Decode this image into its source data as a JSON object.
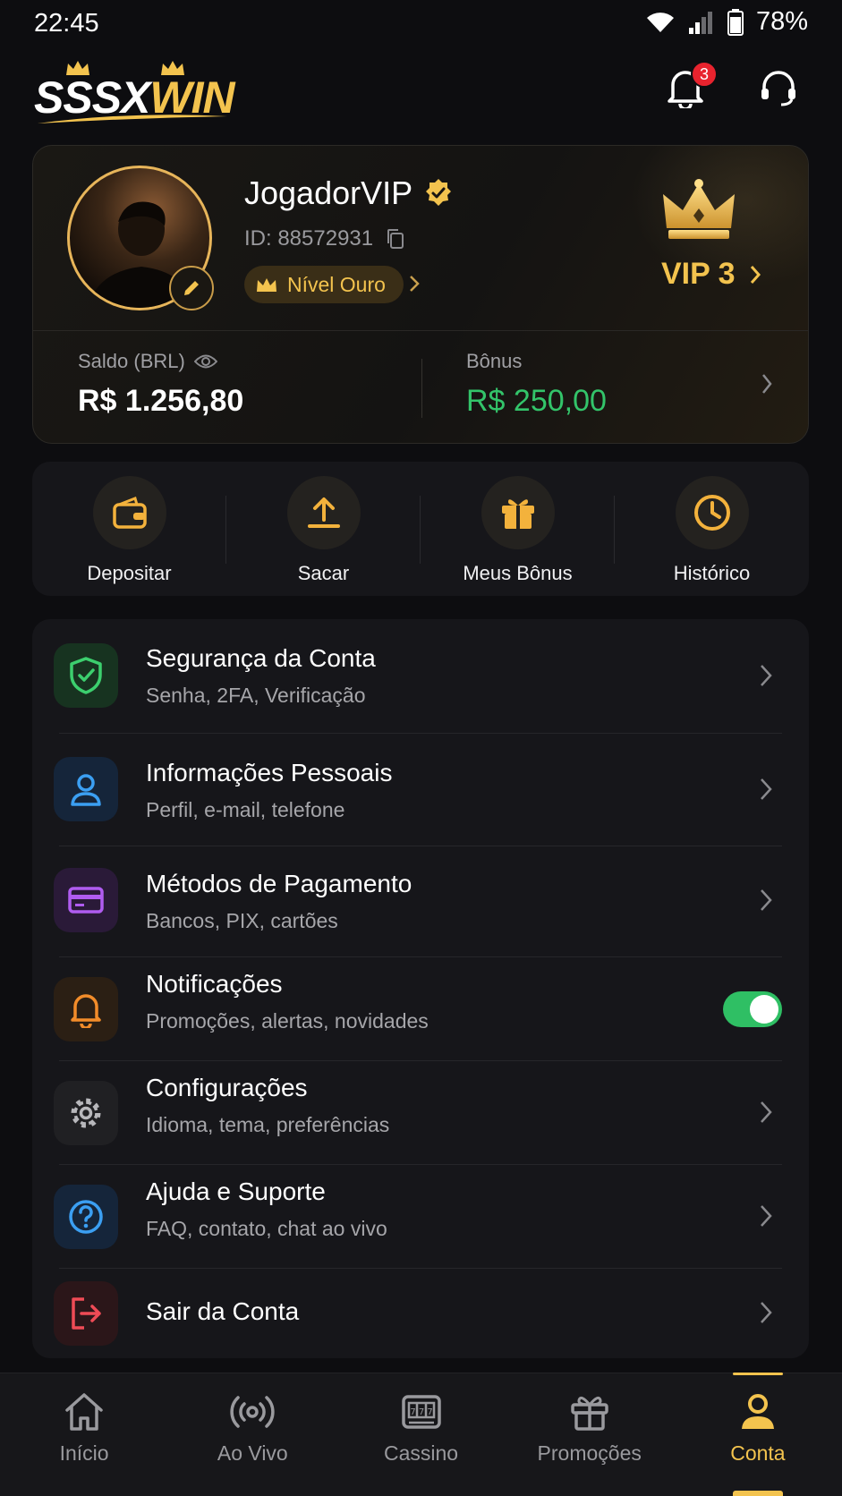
{
  "status_bar": {
    "time": "22:45",
    "battery": "78%"
  },
  "header": {
    "logo_part1": "SSSX",
    "logo_part2": "WIN",
    "notification_count": "3"
  },
  "profile": {
    "username": "JogadorVIP",
    "id": "ID: 88572931",
    "level": "Nível Ouro",
    "vip": "VIP 3",
    "balance_label": "Saldo (BRL)",
    "balance_value": "R$ 1.256,80",
    "bonus_label": "Bônus",
    "bonus_value": "R$ 250,00"
  },
  "actions": [
    {
      "label": "Depositar",
      "icon": "wallet-icon"
    },
    {
      "label": "Sacar",
      "icon": "upload-icon"
    },
    {
      "label": "Meus Bônus",
      "icon": "gift-icon"
    },
    {
      "label": "Histórico",
      "icon": "clock-icon"
    }
  ],
  "menu": [
    {
      "title": "Segurança da Conta",
      "subtitle": "Senha, 2FA, Verificação",
      "icon": "shield-check-icon",
      "color": "#3ccf6e"
    },
    {
      "title": "Informações Pessoais",
      "subtitle": "Perfil, e-mail, telefone",
      "icon": "user-icon",
      "color": "#3b9ff2"
    },
    {
      "title": "Métodos de Pagamento",
      "subtitle": "Bancos, PIX, cartões",
      "icon": "card-icon",
      "color": "#b05cf0"
    },
    {
      "title": "Notificações",
      "subtitle": "Promoções, alertas, novidades",
      "icon": "bell-icon",
      "color": "#f28c2a",
      "toggle_on": true
    },
    {
      "title": "Configurações",
      "subtitle": "Idioma, tema, preferências",
      "icon": "gear-icon",
      "color": "#b8b8bc"
    },
    {
      "title": "Ajuda e Suporte",
      "subtitle": "FAQ, contato, chat ao vivo",
      "icon": "help-icon",
      "color": "#3b9ff2"
    },
    {
      "title": "Sair da Conta",
      "subtitle": "",
      "icon": "logout-icon",
      "color": "#ef4b56"
    }
  ],
  "bottom_nav": [
    {
      "label": "Início",
      "icon": "home-icon",
      "active": false
    },
    {
      "label": "Ao Vivo",
      "icon": "live-icon",
      "active": false
    },
    {
      "label": "Cassino",
      "icon": "slot-machine-icon",
      "active": false
    },
    {
      "label": "Promoções",
      "icon": "gift-icon",
      "active": false
    },
    {
      "label": "Conta",
      "icon": "user-icon",
      "active": true
    }
  ],
  "colors": {
    "accent": "#f3c34e",
    "background": "#0d0d10",
    "positive": "#33c46a"
  }
}
